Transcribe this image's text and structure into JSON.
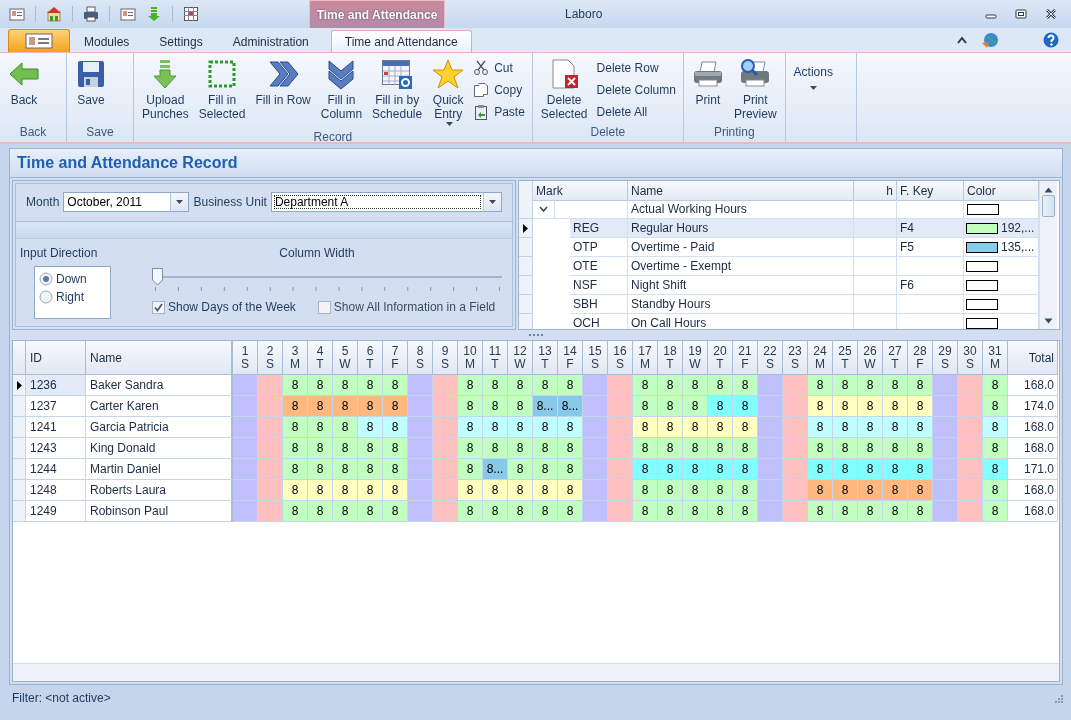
{
  "window": {
    "title": "Laboro",
    "context_title": "Time and Attendance"
  },
  "tabs": [
    {
      "label": "Modules",
      "selected": false
    },
    {
      "label": "Settings",
      "selected": false
    },
    {
      "label": "Administration",
      "selected": false
    },
    {
      "label": "Time and Attendance",
      "selected": true
    }
  ],
  "ribbon": {
    "groups": [
      {
        "label": "Back",
        "buttons": [
          {
            "kind": "large",
            "label": "Back"
          }
        ]
      },
      {
        "label": "Save",
        "buttons": [
          {
            "kind": "large",
            "label": "Save"
          }
        ]
      },
      {
        "label": "Record",
        "buttons": [
          {
            "kind": "large",
            "label": "Upload\nPunches"
          },
          {
            "kind": "large",
            "label": "Fill in\nSelected"
          },
          {
            "kind": "large",
            "label": "Fill in Row"
          },
          {
            "kind": "large",
            "label": "Fill in\nColumn"
          },
          {
            "kind": "large",
            "label": "Fill in by\nSchedule"
          },
          {
            "kind": "large",
            "label": "Quick\nEntry",
            "dropdown": true
          },
          {
            "kind": "small",
            "label": "Cut"
          },
          {
            "kind": "small",
            "label": "Copy"
          },
          {
            "kind": "small",
            "label": "Paste"
          }
        ]
      },
      {
        "label": "Delete",
        "buttons": [
          {
            "kind": "large",
            "label": "Delete\nSelected"
          },
          {
            "kind": "small",
            "label": "Delete Row"
          },
          {
            "kind": "small",
            "label": "Delete Column"
          },
          {
            "kind": "small",
            "label": "Delete All"
          }
        ]
      },
      {
        "label": "Printing",
        "buttons": [
          {
            "kind": "large",
            "label": "Print"
          },
          {
            "kind": "large",
            "label": "Print\nPreview"
          }
        ]
      },
      {
        "buttons": [
          {
            "kind": "large",
            "label": "Actions",
            "dropdown": true
          }
        ]
      }
    ]
  },
  "record_panel": {
    "title": "Time and Attendance Record"
  },
  "filters": {
    "month": {
      "label": "Month",
      "value": "October, 2011"
    },
    "business_unit": {
      "label": "Business Unit",
      "value": "Department A"
    }
  },
  "options": {
    "input_direction": {
      "label": "Input Direction",
      "options": [
        {
          "label": "Down",
          "selected": true
        },
        {
          "label": "Right",
          "selected": false
        }
      ]
    },
    "column_width": {
      "label": "Column Width",
      "level": 0
    },
    "checkboxes": [
      {
        "label": "Show Days of the Week",
        "checked": true
      },
      {
        "label": "Show All Information in a Field",
        "checked": false
      }
    ]
  },
  "marks": {
    "columns": [
      "Mark",
      "Name",
      "h",
      "F. Key",
      "Color"
    ],
    "groups": [
      {
        "name": "Actual Working Hours",
        "expanded": true,
        "color": "#ffffff",
        "children": [
          {
            "mark": "REG",
            "name": "Regular Hours",
            "f_key": "F4",
            "color": "#c0ffc0",
            "color_text": "192,...",
            "selected": true
          },
          {
            "mark": "OTP",
            "name": "Overtime - Paid",
            "f_key": "F5",
            "color": "#87ceeb",
            "color_text": "135,...",
            "selected": false
          },
          {
            "mark": "OTE",
            "name": "Overtime - Exempt",
            "color": "#ffffff",
            "selected": false
          },
          {
            "mark": "NSF",
            "name": "Night Shift",
            "f_key": "F6",
            "color": "#ffffff",
            "selected": false
          },
          {
            "mark": "SBH",
            "name": "Standby Hours",
            "color": "#ffffff",
            "selected": false
          },
          {
            "mark": "OCH",
            "name": "On Call Hours",
            "color": "#ffffff",
            "selected": false
          }
        ]
      }
    ]
  },
  "attendance": {
    "columns": [
      "ID",
      "Name"
    ],
    "total_label": "Total",
    "days": [
      {
        "day": "1",
        "weekday": "S"
      },
      {
        "day": "2",
        "weekday": "S"
      },
      {
        "day": "3",
        "weekday": "M"
      },
      {
        "day": "4",
        "weekday": "T"
      },
      {
        "day": "5",
        "weekday": "W"
      },
      {
        "day": "6",
        "weekday": "T"
      },
      {
        "day": "7",
        "weekday": "F"
      },
      {
        "day": "8",
        "weekday": "S"
      },
      {
        "day": "9",
        "weekday": "S"
      },
      {
        "day": "10",
        "weekday": "M"
      },
      {
        "day": "11",
        "weekday": "T"
      },
      {
        "day": "12",
        "weekday": "W"
      },
      {
        "day": "13",
        "weekday": "T"
      },
      {
        "day": "14",
        "weekday": "F"
      },
      {
        "day": "15",
        "weekday": "S"
      },
      {
        "day": "16",
        "weekday": "S"
      },
      {
        "day": "17",
        "weekday": "M"
      },
      {
        "day": "18",
        "weekday": "T"
      },
      {
        "day": "19",
        "weekday": "W"
      },
      {
        "day": "20",
        "weekday": "T"
      },
      {
        "day": "21",
        "weekday": "F"
      },
      {
        "day": "22",
        "weekday": "S"
      },
      {
        "day": "23",
        "weekday": "S"
      },
      {
        "day": "24",
        "weekday": "M"
      },
      {
        "day": "25",
        "weekday": "T"
      },
      {
        "day": "26",
        "weekday": "W"
      },
      {
        "day": "27",
        "weekday": "T"
      },
      {
        "day": "28",
        "weekday": "F"
      },
      {
        "day": "29",
        "weekday": "S"
      },
      {
        "day": "30",
        "weekday": "S"
      },
      {
        "day": "31",
        "weekday": "M"
      }
    ],
    "rows": [
      {
        "id": "1236",
        "name": "Baker Sandra",
        "selected": true,
        "total": "168.0",
        "cells": [
          {
            "color": "#c0c0ff"
          },
          {
            "color": "#ffc0c0"
          },
          {
            "text": "8",
            "color": "#c0ffc0"
          },
          {
            "text": "8",
            "color": "#c0ffc0"
          },
          {
            "text": "8",
            "color": "#c0ffc0"
          },
          {
            "text": "8",
            "color": "#c0ffc0"
          },
          {
            "text": "8",
            "color": "#c0ffc0"
          },
          {
            "color": "#c0c0ff"
          },
          {
            "color": "#ffc0c0"
          },
          {
            "text": "8",
            "color": "#c0ffc0"
          },
          {
            "text": "8",
            "color": "#c0ffc0"
          },
          {
            "text": "8",
            "color": "#c0ffc0"
          },
          {
            "text": "8",
            "color": "#c0ffc0"
          },
          {
            "text": "8",
            "color": "#c0ffc0"
          },
          {
            "color": "#c0c0ff"
          },
          {
            "color": "#ffc0c0"
          },
          {
            "text": "8",
            "color": "#c0ffc0"
          },
          {
            "text": "8",
            "color": "#c0ffc0"
          },
          {
            "text": "8",
            "color": "#c0ffc0"
          },
          {
            "text": "8",
            "color": "#c0ffc0"
          },
          {
            "text": "8",
            "color": "#c0ffc0"
          },
          {
            "color": "#c0c0ff"
          },
          {
            "color": "#ffc0c0"
          },
          {
            "text": "8",
            "color": "#c0ffc0"
          },
          {
            "text": "8",
            "color": "#c0ffc0"
          },
          {
            "text": "8",
            "color": "#c0ffc0"
          },
          {
            "text": "8",
            "color": "#c0ffc0"
          },
          {
            "text": "8",
            "color": "#c0ffc0"
          },
          {
            "color": "#c0c0ff"
          },
          {
            "color": "#ffc0c0"
          },
          {
            "text": "8",
            "color": "#c0ffc0"
          }
        ]
      },
      {
        "id": "1237",
        "name": "Carter Karen",
        "selected": false,
        "total": "174.0",
        "cells": [
          {
            "color": "#c0c0ff"
          },
          {
            "color": "#ffc0c0"
          },
          {
            "text": "8",
            "color": "#ffb980"
          },
          {
            "text": "8",
            "color": "#ffb980"
          },
          {
            "text": "8",
            "color": "#ffb980"
          },
          {
            "text": "8",
            "color": "#ffb980"
          },
          {
            "text": "8",
            "color": "#ffb980"
          },
          {
            "color": "#c0c0ff"
          },
          {
            "color": "#ffc0c0"
          },
          {
            "text": "8",
            "color": "#c0ffc0"
          },
          {
            "text": "8",
            "color": "#c0ffc0"
          },
          {
            "text": "8",
            "color": "#c0ffc0"
          },
          {
            "text": "8...",
            "color": "#88c8e8"
          },
          {
            "text": "8...",
            "color": "#88c8e8"
          },
          {
            "color": "#c0c0ff"
          },
          {
            "color": "#ffc0c0"
          },
          {
            "text": "8",
            "color": "#c0ffc0"
          },
          {
            "text": "8",
            "color": "#c0ffc0"
          },
          {
            "text": "8",
            "color": "#c0ffc0"
          },
          {
            "text": "8",
            "color": "#80ffff"
          },
          {
            "text": "8",
            "color": "#80ffff"
          },
          {
            "color": "#c0c0ff"
          },
          {
            "color": "#ffc0c0"
          },
          {
            "text": "8",
            "color": "#ffffc0"
          },
          {
            "text": "8",
            "color": "#ffffc0"
          },
          {
            "text": "8",
            "color": "#ffffc0"
          },
          {
            "text": "8",
            "color": "#ffffc0"
          },
          {
            "text": "8",
            "color": "#ffffc0"
          },
          {
            "color": "#c0c0ff"
          },
          {
            "color": "#ffc0c0"
          },
          {
            "text": "8",
            "color": "#c0ffc0"
          }
        ]
      },
      {
        "id": "1241",
        "name": "Garcia Patricia",
        "selected": false,
        "total": "168.0",
        "cells": [
          {
            "color": "#c0c0ff"
          },
          {
            "color": "#ffc0c0"
          },
          {
            "text": "8",
            "color": "#c0ffc0"
          },
          {
            "text": "8",
            "color": "#c0ffc0"
          },
          {
            "text": "8",
            "color": "#c0ffc0"
          },
          {
            "text": "8",
            "color": "#c0ffff"
          },
          {
            "text": "8",
            "color": "#c0ffff"
          },
          {
            "color": "#c0c0ff"
          },
          {
            "color": "#ffc0c0"
          },
          {
            "text": "8",
            "color": "#c0ffff"
          },
          {
            "text": "8",
            "color": "#c0ffff"
          },
          {
            "text": "8",
            "color": "#c0ffff"
          },
          {
            "text": "8",
            "color": "#c0ffff"
          },
          {
            "text": "8",
            "color": "#c0ffff"
          },
          {
            "color": "#c0c0ff"
          },
          {
            "color": "#ffc0c0"
          },
          {
            "text": "8",
            "color": "#ffffc0"
          },
          {
            "text": "8",
            "color": "#ffffc0"
          },
          {
            "text": "8",
            "color": "#ffffc0"
          },
          {
            "text": "8",
            "color": "#ffffc0"
          },
          {
            "text": "8",
            "color": "#ffffc0"
          },
          {
            "color": "#c0c0ff"
          },
          {
            "color": "#ffc0c0"
          },
          {
            "text": "8",
            "color": "#c0ffff"
          },
          {
            "text": "8",
            "color": "#c0ffff"
          },
          {
            "text": "8",
            "color": "#c0ffff"
          },
          {
            "text": "8",
            "color": "#c0ffff"
          },
          {
            "text": "8",
            "color": "#c0ffff"
          },
          {
            "color": "#c0c0ff"
          },
          {
            "color": "#ffc0c0"
          },
          {
            "text": "8",
            "color": "#c0ffff"
          }
        ]
      },
      {
        "id": "1243",
        "name": "King Donald",
        "selected": false,
        "total": "168.0",
        "cells": [
          {
            "color": "#c0c0ff"
          },
          {
            "color": "#ffc0c0"
          },
          {
            "text": "8",
            "color": "#c0ffc0"
          },
          {
            "text": "8",
            "color": "#c0ffc0"
          },
          {
            "text": "8",
            "color": "#c0ffc0"
          },
          {
            "text": "8",
            "color": "#c0ffc0"
          },
          {
            "text": "8",
            "color": "#c0ffc0"
          },
          {
            "color": "#c0c0ff"
          },
          {
            "color": "#ffc0c0"
          },
          {
            "text": "8",
            "color": "#c0ffc0"
          },
          {
            "text": "8",
            "color": "#c0ffc0"
          },
          {
            "text": "8",
            "color": "#c0ffc0"
          },
          {
            "text": "8",
            "color": "#c0ffc0"
          },
          {
            "text": "8",
            "color": "#c0ffc0"
          },
          {
            "color": "#c0c0ff"
          },
          {
            "color": "#ffc0c0"
          },
          {
            "text": "8",
            "color": "#c0ffc0"
          },
          {
            "text": "8",
            "color": "#c0ffc0"
          },
          {
            "text": "8",
            "color": "#c0ffc0"
          },
          {
            "text": "8",
            "color": "#c0ffc0"
          },
          {
            "text": "8",
            "color": "#c0ffc0"
          },
          {
            "color": "#c0c0ff"
          },
          {
            "color": "#ffc0c0"
          },
          {
            "text": "8",
            "color": "#c0ffc0"
          },
          {
            "text": "8",
            "color": "#c0ffc0"
          },
          {
            "text": "8",
            "color": "#c0ffc0"
          },
          {
            "text": "8",
            "color": "#c0ffc0"
          },
          {
            "text": "8",
            "color": "#c0ffc0"
          },
          {
            "color": "#c0c0ff"
          },
          {
            "color": "#ffc0c0"
          },
          {
            "text": "8",
            "color": "#c0ffc0"
          }
        ]
      },
      {
        "id": "1244",
        "name": "Martin Daniel",
        "selected": false,
        "total": "171.0",
        "cells": [
          {
            "color": "#c0c0ff"
          },
          {
            "color": "#ffc0c0"
          },
          {
            "text": "8",
            "color": "#c0ffc0"
          },
          {
            "text": "8",
            "color": "#c0ffc0"
          },
          {
            "text": "8",
            "color": "#c0ffc0"
          },
          {
            "text": "8",
            "color": "#c0ffc0"
          },
          {
            "text": "8",
            "color": "#c0ffc0"
          },
          {
            "color": "#c0c0ff"
          },
          {
            "color": "#ffc0c0"
          },
          {
            "text": "8",
            "color": "#c0ffc0"
          },
          {
            "text": "8...",
            "color": "#88c8e8"
          },
          {
            "text": "8",
            "color": "#c0ffc0"
          },
          {
            "text": "8",
            "color": "#c0ffc0"
          },
          {
            "text": "8",
            "color": "#c0ffc0"
          },
          {
            "color": "#c0c0ff"
          },
          {
            "color": "#ffc0c0"
          },
          {
            "text": "8",
            "color": "#80ffff"
          },
          {
            "text": "8",
            "color": "#80ffff"
          },
          {
            "text": "8",
            "color": "#80ffff"
          },
          {
            "text": "8",
            "color": "#80ffff"
          },
          {
            "text": "8",
            "color": "#80ffff"
          },
          {
            "color": "#c0c0ff"
          },
          {
            "color": "#ffc0c0"
          },
          {
            "text": "8",
            "color": "#80ffff"
          },
          {
            "text": "8",
            "color": "#80ffff"
          },
          {
            "text": "8",
            "color": "#80ffff"
          },
          {
            "text": "8",
            "color": "#80ffff"
          },
          {
            "text": "8",
            "color": "#80ffff"
          },
          {
            "color": "#c0c0ff"
          },
          {
            "color": "#ffc0c0"
          },
          {
            "text": "8",
            "color": "#80ffff"
          }
        ]
      },
      {
        "id": "1248",
        "name": "Roberts Laura",
        "selected": false,
        "total": "168.0",
        "cells": [
          {
            "color": "#c0c0ff"
          },
          {
            "color": "#ffc0c0"
          },
          {
            "text": "8",
            "color": "#ffffc0"
          },
          {
            "text": "8",
            "color": "#ffffc0"
          },
          {
            "text": "8",
            "color": "#ffffc0"
          },
          {
            "text": "8",
            "color": "#ffffc0"
          },
          {
            "text": "8",
            "color": "#ffffc0"
          },
          {
            "color": "#c0c0ff"
          },
          {
            "color": "#ffc0c0"
          },
          {
            "text": "8",
            "color": "#ffffc0"
          },
          {
            "text": "8",
            "color": "#ffffc0"
          },
          {
            "text": "8",
            "color": "#ffffc0"
          },
          {
            "text": "8",
            "color": "#ffffc0"
          },
          {
            "text": "8",
            "color": "#ffffc0"
          },
          {
            "color": "#c0c0ff"
          },
          {
            "color": "#ffc0c0"
          },
          {
            "text": "8",
            "color": "#c0ffc0"
          },
          {
            "text": "8",
            "color": "#c0ffc0"
          },
          {
            "text": "8",
            "color": "#c0ffc0"
          },
          {
            "text": "8",
            "color": "#c0ffc0"
          },
          {
            "text": "8",
            "color": "#c0ffc0"
          },
          {
            "color": "#c0c0ff"
          },
          {
            "color": "#ffc0c0"
          },
          {
            "text": "8",
            "color": "#ffb980"
          },
          {
            "text": "8",
            "color": "#ffb980"
          },
          {
            "text": "8",
            "color": "#ffb980"
          },
          {
            "text": "8",
            "color": "#ffb980"
          },
          {
            "text": "8",
            "color": "#ffb980"
          },
          {
            "color": "#c0c0ff"
          },
          {
            "color": "#ffc0c0"
          },
          {
            "text": "8",
            "color": "#c0ffc0"
          }
        ]
      },
      {
        "id": "1249",
        "name": "Robinson Paul",
        "selected": false,
        "total": "168.0",
        "cells": [
          {
            "color": "#c0c0ff"
          },
          {
            "color": "#ffc0c0"
          },
          {
            "text": "8",
            "color": "#c0ffc0"
          },
          {
            "text": "8",
            "color": "#c0ffc0"
          },
          {
            "text": "8",
            "color": "#c0ffc0"
          },
          {
            "text": "8",
            "color": "#c0ffc0"
          },
          {
            "text": "8",
            "color": "#c0ffc0"
          },
          {
            "color": "#c0c0ff"
          },
          {
            "color": "#ffc0c0"
          },
          {
            "text": "8",
            "color": "#c0ffc0"
          },
          {
            "text": "8",
            "color": "#c0ffc0"
          },
          {
            "text": "8",
            "color": "#c0ffc0"
          },
          {
            "text": "8",
            "color": "#c0ffc0"
          },
          {
            "text": "8",
            "color": "#c0ffc0"
          },
          {
            "color": "#c0c0ff"
          },
          {
            "color": "#ffc0c0"
          },
          {
            "text": "8",
            "color": "#c0ffc0"
          },
          {
            "text": "8",
            "color": "#c0ffc0"
          },
          {
            "text": "8",
            "color": "#c0ffc0"
          },
          {
            "text": "8",
            "color": "#c0ffc0"
          },
          {
            "text": "8",
            "color": "#c0ffc0"
          },
          {
            "color": "#c0c0ff"
          },
          {
            "color": "#ffc0c0"
          },
          {
            "text": "8",
            "color": "#c0ffc0"
          },
          {
            "text": "8",
            "color": "#c0ffc0"
          },
          {
            "text": "8",
            "color": "#c0ffc0"
          },
          {
            "text": "8",
            "color": "#c0ffc0"
          },
          {
            "text": "8",
            "color": "#c0ffc0"
          },
          {
            "color": "#c0c0ff"
          },
          {
            "color": "#ffc0c0"
          },
          {
            "text": "8",
            "color": "#c0ffc0"
          }
        ]
      }
    ]
  },
  "status_bar": {
    "filter": "Filter: <not active>"
  }
}
